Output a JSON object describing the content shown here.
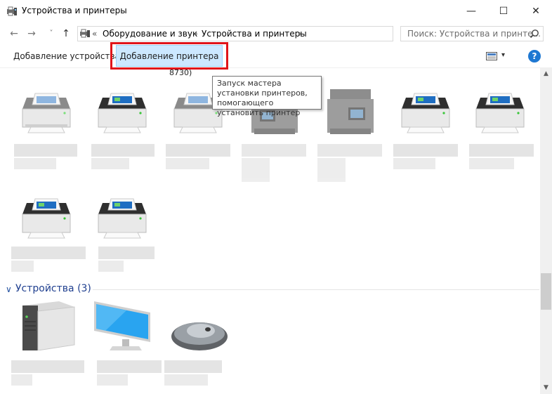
{
  "window": {
    "title": "Устройства и принтеры",
    "minimize_glyph": "—",
    "maximize_glyph": "☐",
    "close_glyph": "✕"
  },
  "address": {
    "back": "←",
    "forward": "→",
    "recent": "˅",
    "up": "↑",
    "overflow": "«",
    "crumbs": [
      "Оборудование и звук",
      "Устройства и принтеры"
    ],
    "separator": "›",
    "refresh": "↻"
  },
  "search": {
    "placeholder": "Поиск: Устройства и принте..."
  },
  "toolbar": {
    "add_device": "Добавление устройства",
    "add_printer": "Добавление принтера",
    "view_caret": "▾",
    "help": "?"
  },
  "tooltip": {
    "text": "Запуск мастера установки принтеров, помогающего установить принтер"
  },
  "cutoff_label": "8730)",
  "sections": {
    "devices": {
      "caret": "∨",
      "title": "Устройства (3)"
    }
  },
  "printers": [
    {
      "icon": "printer-icon-light",
      "dim": false
    },
    {
      "icon": "printer-icon",
      "dim": false
    },
    {
      "icon": "printer-icon-light",
      "dim": false
    },
    {
      "icon": "mfp-printer-icon",
      "dim": true
    },
    {
      "icon": "mfp-printer-icon",
      "dim": true
    },
    {
      "icon": "printer-icon",
      "dim": false
    },
    {
      "icon": "printer-icon",
      "dim": false
    },
    {
      "icon": "printer-icon",
      "dim": false
    },
    {
      "icon": "printer-icon",
      "dim": false
    }
  ],
  "devices": [
    {
      "icon": "computer-tower-icon"
    },
    {
      "icon": "monitor-icon"
    },
    {
      "icon": "mouse-icon"
    }
  ],
  "scrollbar": {
    "up": "▲",
    "down": "▼"
  },
  "colors": {
    "accent": "#1e78d2",
    "highlight_frame": "#e0141a",
    "button_selected_bg": "#cce8ff",
    "section_title": "#1f3f8f"
  }
}
